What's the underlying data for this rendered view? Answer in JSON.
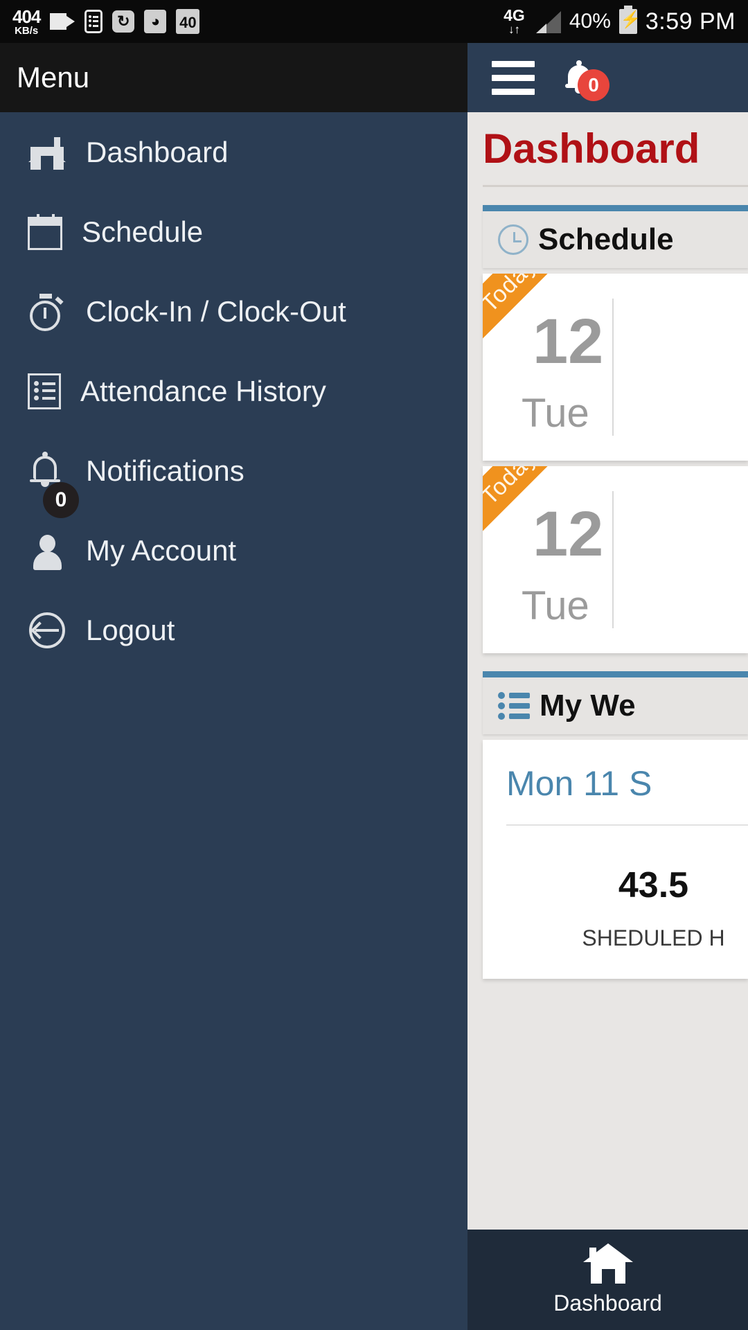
{
  "status_bar": {
    "network_speed_value": "404",
    "network_speed_unit": "KB/s",
    "icons": [
      "video-icon",
      "list-icon",
      "sync-icon",
      "wifi-icon",
      "forty-badge-icon"
    ],
    "forty_badge": "40",
    "network_type": "4G",
    "data_arrows": "↓↑",
    "battery_percent": "40%",
    "time": "3:59 PM"
  },
  "drawer": {
    "title": "Menu",
    "items": [
      {
        "label": "Dashboard",
        "icon": "home-icon"
      },
      {
        "label": "Schedule",
        "icon": "calendar-icon"
      },
      {
        "label": "Clock-In / Clock-Out",
        "icon": "stopwatch-icon"
      },
      {
        "label": "Attendance History",
        "icon": "list-icon"
      },
      {
        "label": "Notifications",
        "icon": "bell-icon",
        "badge": "0"
      },
      {
        "label": "My Account",
        "icon": "user-icon"
      },
      {
        "label": "Logout",
        "icon": "logout-icon"
      }
    ]
  },
  "app_bar": {
    "menu_icon": "hamburger-icon",
    "notification_icon": "bell-icon",
    "notification_badge": "0"
  },
  "main": {
    "page_title": "Dashboard",
    "schedule_panel": {
      "heading": "Schedule",
      "icon": "clock-icon",
      "days": [
        {
          "ribbon": "Today",
          "date_number": "12",
          "day_name": "Tue"
        },
        {
          "ribbon": "Today",
          "date_number": "12",
          "day_name": "Tue"
        }
      ]
    },
    "week_panel": {
      "heading": "My We",
      "icon": "bullet-list-icon",
      "date_label": "Mon 11 S",
      "hours_value": "43.5",
      "hours_label": "SHEDULED H"
    }
  },
  "bottom_nav": {
    "items": [
      {
        "label": "Dashboard",
        "icon": "home-icon",
        "active": true
      }
    ]
  },
  "colors": {
    "sidebar": "#2b3d54",
    "app_bar": "#2b3d54",
    "title_red": "#b01116",
    "panel_accent_blue": "#4a86ad",
    "ribbon_orange": "#f0921e",
    "badge_red": "#e8453c",
    "bottom_nav": "#1f2b3a"
  }
}
